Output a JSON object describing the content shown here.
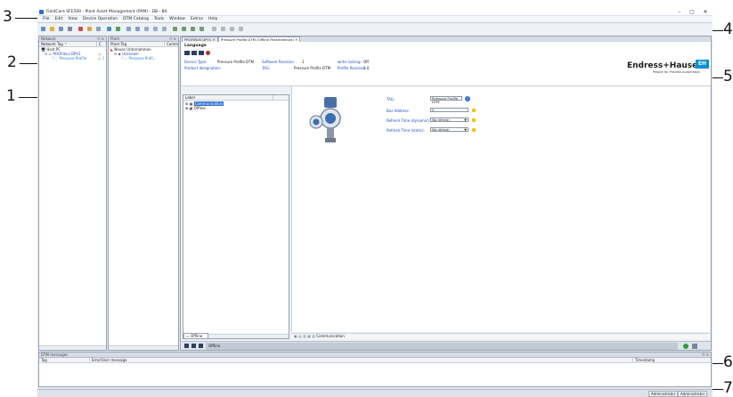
{
  "window": {
    "title": "FieldCare SFE500 - Plant Asset Management (PAM) - DB - BA",
    "minimize": "–",
    "maximize": "▢",
    "close": "✕"
  },
  "menu": [
    "File",
    "Edit",
    "View",
    "Device Operation",
    "DTM Catalog",
    "Tools",
    "Window",
    "Extras",
    "Help"
  ],
  "callouts": {
    "c1": "1",
    "c2": "2",
    "c3": "3",
    "c4": "4",
    "c5": "5",
    "c6": "6",
    "c7": "7"
  },
  "network_panel": {
    "title": "Network",
    "pin": "⊓ ✕",
    "col1": "Network Tag",
    "col2": "C",
    "items": [
      "Host PC",
      "PROFIbus DPV1",
      "Pressure Profile"
    ],
    "item_status": [
      "",
      "◎",
      "◎ 1"
    ]
  },
  "plant_panel": {
    "title": "Plant",
    "pin": "⊓ ✕",
    "col1": "Plant Tag",
    "col2": "Comm",
    "items": [
      "Neues Unternehmen",
      "Unknown",
      "Pressure Profi..."
    ]
  },
  "doc_tabs": [
    "PROFIBUS DPV1",
    "Pressure Profile DTM (Offline Parameterize)"
  ],
  "doc_tab_close": "✕",
  "device": {
    "language_label": "Language",
    "device_type_label": "Device Type:",
    "device_type_value": "Pressure Profile DTM",
    "product_designation_label": "Product designation:",
    "software_revision_label": "Software Revision:",
    "software_revision_value": "1",
    "tag_label": "TAG:",
    "tag_value": "Pressure Profile DTM",
    "write_locking_label": "write locking:",
    "write_locking_value": "Off",
    "profile_revision_label": "Profile Revision:",
    "profile_revision_value": "3.0",
    "brand": "Endress+Hauser",
    "brand_badge": "EH",
    "brand_tagline": "People for Process Automation"
  },
  "tree": {
    "header": "Label",
    "items": [
      "Communication",
      "Offline"
    ]
  },
  "params": {
    "tag_label": "TAG:",
    "tag_value": "Pressure Profile DTM",
    "bus_address_label": "Bus Address:",
    "bus_address_value": "0",
    "refresh_dynamic_label": "Refresh Time (dynamic):",
    "refresh_dynamic_value": "No refresh",
    "refresh_static_label": "Refresh Time (static):",
    "refresh_static_value": "No refresh"
  },
  "bottom_tabs": {
    "offline_tab": "Offline",
    "communication": "Communication",
    "status_offline": "Offline"
  },
  "dtm_messages": {
    "title": "DTM messages",
    "pin": "⊓ ✕",
    "columns": [
      "Tag",
      "Error/User message",
      "Timestamp"
    ]
  },
  "statusbar": {
    "user": "Administrator",
    "role": "Administrator"
  },
  "colors": {
    "accent": "#3070d0",
    "eh_blue": "#0091d6"
  }
}
